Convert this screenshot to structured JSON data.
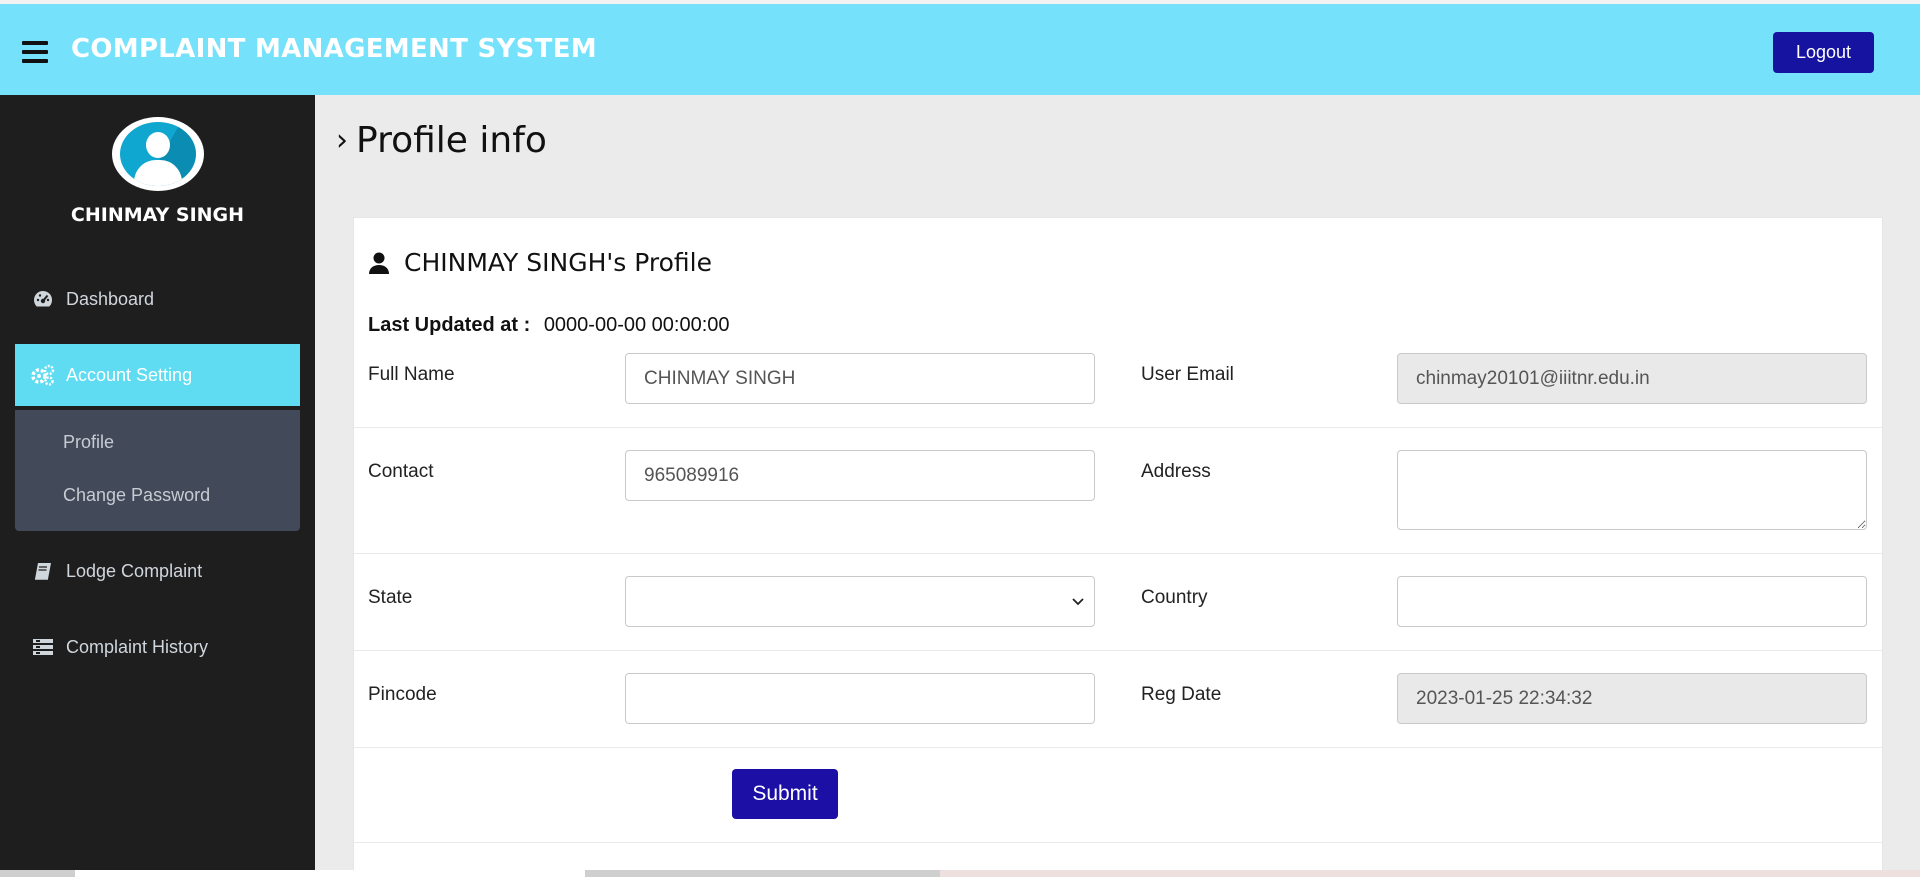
{
  "header": {
    "title": "COMPLAINT MANAGEMENT SYSTEM",
    "logout_label": "Logout",
    "colors": {
      "bar": "#76e1fb",
      "button": "#1513a0"
    }
  },
  "sidebar": {
    "user_name": "CHINMAY SINGH",
    "items": [
      {
        "label": "Dashboard",
        "icon": "dashboard-gauge-icon"
      },
      {
        "label": "Account Setting",
        "icon": "gears-icon",
        "active": true
      },
      {
        "label": "Lodge Complaint",
        "icon": "book-icon"
      },
      {
        "label": "Complaint History",
        "icon": "list-icon"
      }
    ],
    "submenu": [
      {
        "label": "Profile"
      },
      {
        "label": "Change Password"
      }
    ],
    "colors": {
      "background": "#1e1e1e",
      "active": "#5fdcf2",
      "submenu": "#424958"
    }
  },
  "page": {
    "title": "Profile info"
  },
  "profile": {
    "heading": "CHINMAY SINGH's Profile",
    "last_updated_label": "Last Updated at :",
    "last_updated_value": "0000-00-00 00:00:00",
    "fields": {
      "full_name": {
        "label": "Full Name",
        "value": "CHINMAY SINGH"
      },
      "user_email": {
        "label": "User Email",
        "value": "chinmay20101@iiitnr.edu.in",
        "readonly": true
      },
      "contact": {
        "label": "Contact",
        "value": "965089916"
      },
      "address": {
        "label": "Address",
        "value": ""
      },
      "state": {
        "label": "State",
        "value": ""
      },
      "country": {
        "label": "Country",
        "value": ""
      },
      "pincode": {
        "label": "Pincode",
        "value": ""
      },
      "reg_date": {
        "label": "Reg Date",
        "value": "2023-01-25 22:34:32",
        "readonly": true
      }
    },
    "submit_label": "Submit"
  }
}
